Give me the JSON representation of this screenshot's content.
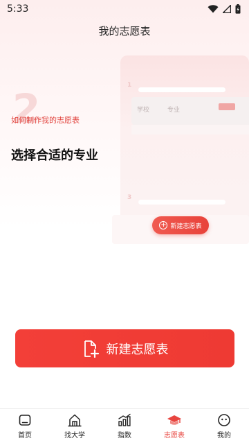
{
  "status_bar": {
    "time": "5:33",
    "icons": [
      "wifi-icon",
      "signal-icon",
      "battery-icon"
    ]
  },
  "page": {
    "title": "我的志愿表"
  },
  "intro": {
    "step_number": "2",
    "subtitle": "如何制作我的志愿表",
    "heading": "选择合适的专业"
  },
  "mockup": {
    "row_number_1": "1",
    "row_number_3": "3",
    "card_label_school": "学校",
    "card_label_major": "专业",
    "button_label": "新建志愿表"
  },
  "cta": {
    "label": "新建志愿表",
    "icon": "add-file-icon"
  },
  "nav": {
    "items": [
      {
        "label": "首页",
        "icon": "home-icon"
      },
      {
        "label": "找大学",
        "icon": "university-icon"
      },
      {
        "label": "指数",
        "icon": "chart-icon"
      },
      {
        "label": "志愿表",
        "icon": "graduation-cap-icon"
      },
      {
        "label": "我的",
        "icon": "profile-icon"
      }
    ],
    "active_index": 3
  },
  "colors": {
    "accent": "#ee3a33",
    "active_nav": "#e8453f",
    "subtitle": "#e2453f"
  }
}
